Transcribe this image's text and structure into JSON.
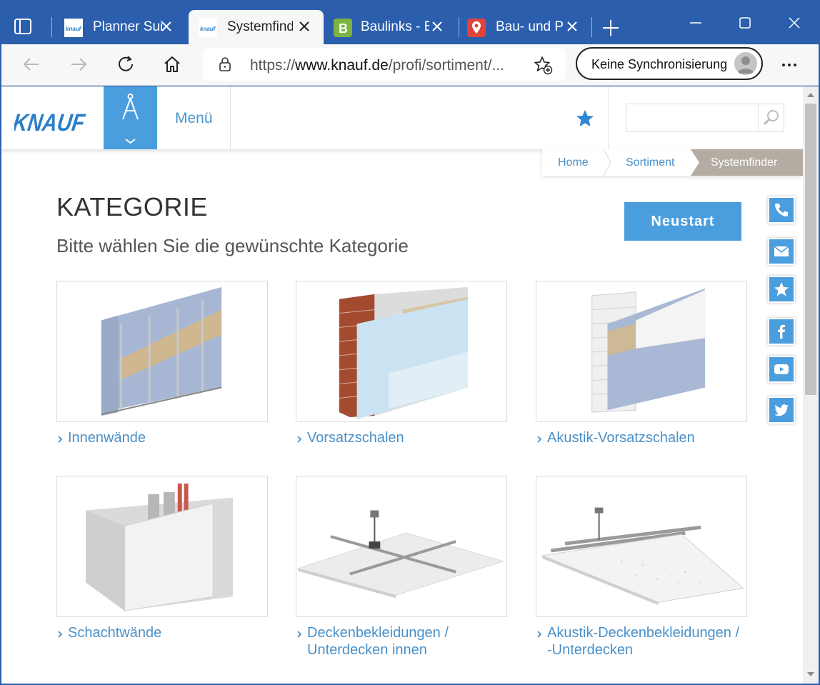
{
  "browser": {
    "tabs": [
      {
        "title": "Planner Sui",
        "active": false
      },
      {
        "title": "Systemfind",
        "active": true
      },
      {
        "title": "Baulinks - B",
        "active": false
      },
      {
        "title": "Bau- und Pl",
        "active": false
      }
    ],
    "url": {
      "prefix": "https://",
      "domain": "www.knauf.de",
      "path": "/profi/sortiment/..."
    },
    "sync_label": "Keine Synchronisierung",
    "colors": {
      "frame": "#2b5fae",
      "toolbar": "#f7f7f7"
    }
  },
  "site": {
    "logo_text": "KNAUF",
    "menu_label": "Menü",
    "search": {
      "placeholder": ""
    },
    "breadcrumb": [
      {
        "label": "Home"
      },
      {
        "label": "Sortiment"
      },
      {
        "label": "Systemfinder",
        "active": true
      }
    ],
    "colors": {
      "accent": "#4a9ede",
      "link": "#4a90c8",
      "breadcrumb_active": "#b4aca2"
    }
  },
  "page": {
    "title": "KATEGORIE",
    "subtitle": "Bitte wählen Sie die gewünschte Kategorie",
    "restart_label": "Neustart"
  },
  "social": [
    {
      "icon": "phone-icon"
    },
    {
      "icon": "mail-icon"
    },
    {
      "icon": "star-icon"
    },
    {
      "icon": "facebook-icon"
    },
    {
      "icon": "youtube-icon"
    },
    {
      "icon": "twitter-icon"
    }
  ],
  "categories": [
    {
      "label": "Innenwände"
    },
    {
      "label": "Vorsatzschalen"
    },
    {
      "label": "Akustik-Vorsatzschalen"
    },
    {
      "label": "Schachtwände"
    },
    {
      "label": "Deckenbekleidungen / Unterdecken innen"
    },
    {
      "label": "Akustik-Deckenbekleidungen / -Unterdecken"
    }
  ]
}
